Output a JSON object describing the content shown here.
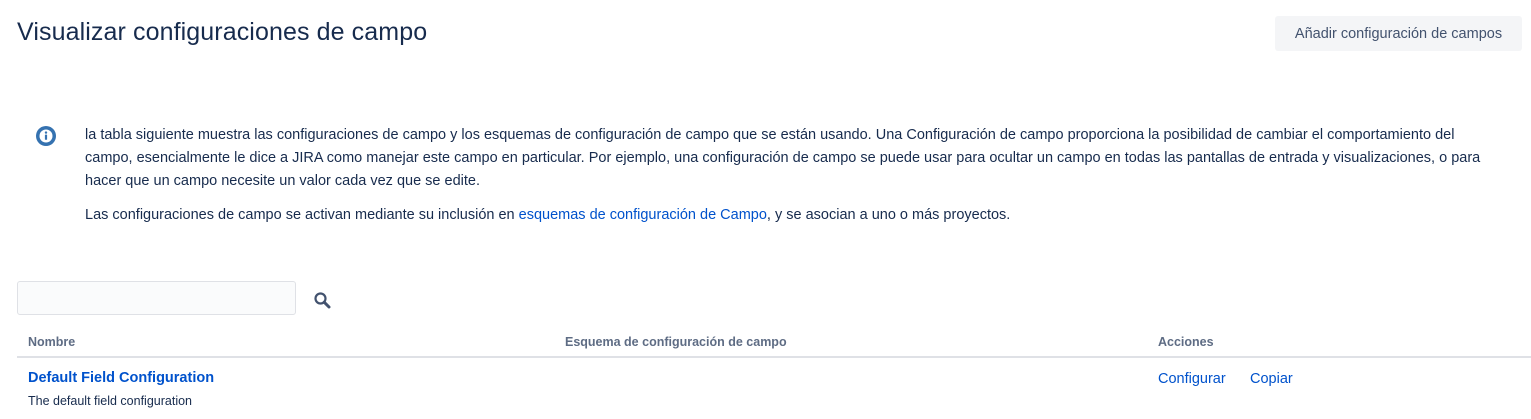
{
  "header": {
    "title": "Visualizar configuraciones de campo",
    "add_button_label": "Añadir configuración de campos"
  },
  "info": {
    "icon": "info-icon",
    "paragraph1": "la tabla siguiente muestra las configuraciones de campo y los esquemas de configuración de campo que se están usando. Una Configuración de campo proporciona la posibilidad de cambiar el comportamiento del campo, esencialmente le dice a JIRA como manejar este campo en particular. Por ejemplo, una configuración de campo se puede usar para ocultar un campo en todas las pantallas de entrada y visualizaciones, o para hacer que un campo necesite un valor cada vez que se edite.",
    "paragraph2_before": "Las configuraciones de campo se activan mediante su inclusión en ",
    "paragraph2_link": "esquemas de configuración de Campo",
    "paragraph2_after": ", y se asocian a uno o más proyectos."
  },
  "search": {
    "value": "",
    "placeholder": "",
    "icon": "search-icon"
  },
  "table": {
    "columns": [
      "Nombre",
      "Esquema de configuración de campo",
      "Acciones"
    ],
    "rows": [
      {
        "name": "Default Field Configuration",
        "description": "The default field configuration",
        "scheme": "",
        "actions": [
          "Configurar",
          "Copiar"
        ]
      }
    ]
  },
  "colors": {
    "link": "#0052cc",
    "text": "#172b4d",
    "muted": "#5e6c84",
    "info_icon": "#3572b0"
  }
}
